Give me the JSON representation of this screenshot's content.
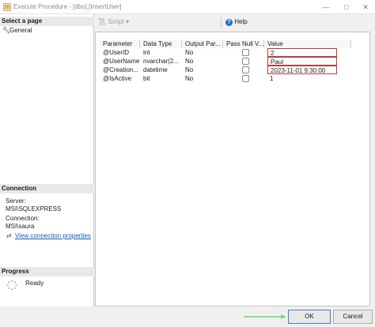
{
  "window": {
    "title": "Execute Procedure - [dbo].[InsertUser]",
    "minimize_glyph": "—",
    "maximize_glyph": "□",
    "close_glyph": "✕"
  },
  "left_pane": {
    "select_page_header": "Select a page",
    "pages": [
      {
        "label": "General",
        "icon": "wrench-icon"
      }
    ],
    "connection_header": "Connection",
    "server_label": "Server:",
    "server_value": "MSI\\SQLEXPRESS",
    "connection_label": "Connection:",
    "connection_value": "MSI\\saura",
    "view_connection_link": "View connection properties",
    "progress_header": "Progress",
    "progress_status": "Ready"
  },
  "toolbar": {
    "script_label": "Script",
    "script_arrow": "▾",
    "help_label": "Help",
    "help_glyph": "?"
  },
  "grid": {
    "columns": [
      "Parameter",
      "Data Type",
      "Output Par...",
      "Pass Null V...",
      "Value"
    ],
    "rows": [
      {
        "parameter": "@UserID",
        "data_type": "int",
        "output": "No",
        "value": "2"
      },
      {
        "parameter": "@UserName",
        "data_type": "nvarchar(2...",
        "output": "No",
        "value": "Paul"
      },
      {
        "parameter": "@Creation...",
        "data_type": "datetime",
        "output": "No",
        "value": "2023-11-01 9:30:00"
      },
      {
        "parameter": "@IsActive",
        "data_type": "bit",
        "output": "No",
        "value": "1"
      }
    ]
  },
  "buttons": {
    "ok": "OK",
    "cancel": "Cancel"
  },
  "colors": {
    "highlight_border": "#c03a3a",
    "arrow": "#6ddc6d",
    "link": "#0b5fb6",
    "ok_border": "#3b7fd6"
  }
}
